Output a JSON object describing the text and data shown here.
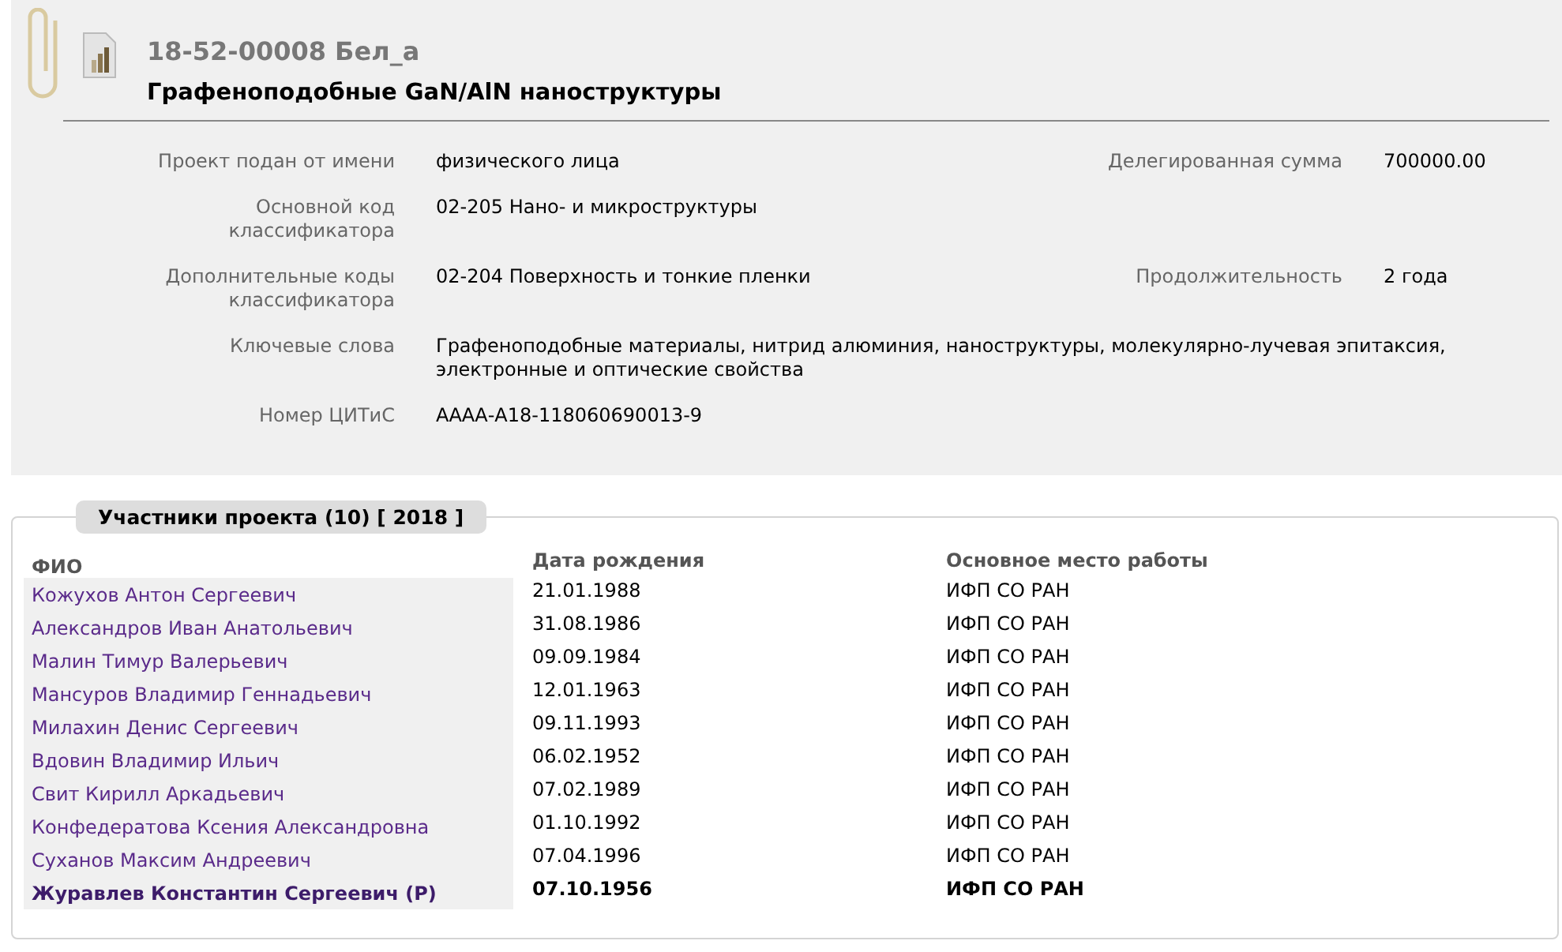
{
  "project": {
    "code": "18-52-00008 Бел_а",
    "title": "Графеноподобные GaN/AlN наноструктуры"
  },
  "fields": [
    {
      "label": "Проект подан от имени",
      "value": "физического лица",
      "side_label": "Делегированная сумма",
      "side_value": "700000.00"
    },
    {
      "label": "Основной код классификатора",
      "value": "02-205 Нано- и микроструктуры"
    },
    {
      "label": "Дополнительные коды классификатора",
      "value": "02-204 Поверхность и тонкие пленки",
      "side_label": "Продолжительность",
      "side_value": "2 года"
    },
    {
      "label": "Ключевые слова",
      "value": "Графеноподобные материалы, нитрид алюминия, наноструктуры, молекулярно-лучевая эпитаксия, электронные и оптические свойства"
    },
    {
      "label": "Номер ЦИТиС",
      "value": "АААА-А18-118060690013-9"
    }
  ],
  "participants": {
    "legend": "Участники проекта (10)",
    "year": "[ 2018 ]",
    "columns": [
      "ФИО",
      "Дата рождения",
      "Основное место работы"
    ],
    "rows": [
      {
        "name": "Кожухов Антон Сергеевич",
        "birth": "21.01.1988",
        "work": "ИФП СО РАН",
        "leader": false
      },
      {
        "name": "Александров Иван Анатольевич",
        "birth": "31.08.1986",
        "work": "ИФП СО РАН",
        "leader": false
      },
      {
        "name": "Малин Тимур Валерьевич",
        "birth": "09.09.1984",
        "work": "ИФП СО РАН",
        "leader": false
      },
      {
        "name": "Мансуров Владимир Геннадьевич",
        "birth": "12.01.1963",
        "work": "ИФП СО РАН",
        "leader": false
      },
      {
        "name": "Милахин Денис Сергеевич",
        "birth": "09.11.1993",
        "work": "ИФП СО РАН",
        "leader": false
      },
      {
        "name": "Вдовин Владимир Ильич",
        "birth": "06.02.1952",
        "work": "ИФП СО РАН",
        "leader": false
      },
      {
        "name": "Свит Кирилл Аркадьевич",
        "birth": "07.02.1989",
        "work": "ИФП СО РАН",
        "leader": false
      },
      {
        "name": "Конфедератова Ксения Александровна",
        "birth": "01.10.1992",
        "work": "ИФП СО РАН",
        "leader": false
      },
      {
        "name": "Суханов Максим Андреевич",
        "birth": "07.04.1996",
        "work": "ИФП СО РАН",
        "leader": false
      },
      {
        "name": "Журавлев Константин Сергеевич (Р)",
        "birth": "07.10.1956",
        "work": "ИФП СО РАН",
        "leader": true
      }
    ]
  }
}
